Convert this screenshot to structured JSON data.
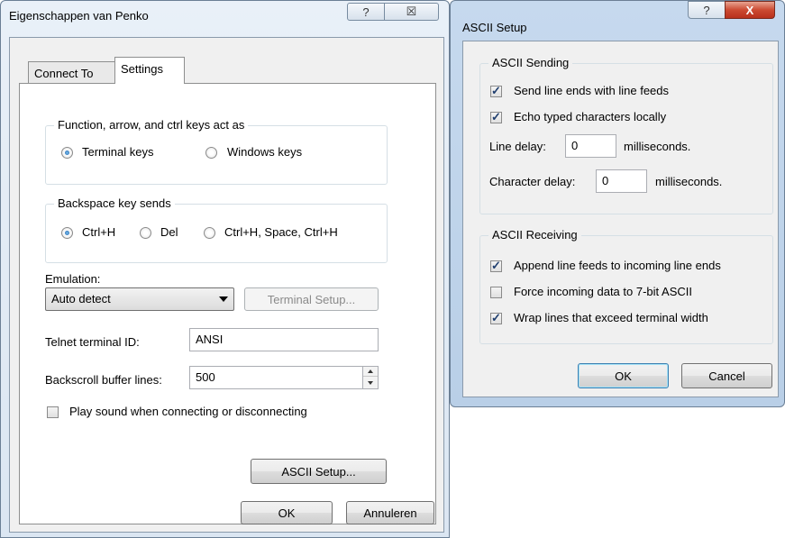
{
  "props": {
    "title": "Eigenschappen van Penko",
    "help_glyph": "?",
    "close_glyph": "☒",
    "tabs": [
      {
        "label": "Connect To"
      },
      {
        "label": "Settings"
      }
    ],
    "keys_group": {
      "title": "Function, arrow, and ctrl keys act as",
      "options": [
        {
          "label": "Terminal keys",
          "selected": true
        },
        {
          "label": "Windows keys",
          "selected": false
        }
      ]
    },
    "backspace_group": {
      "title": "Backspace key sends",
      "options": [
        {
          "label": "Ctrl+H",
          "selected": true
        },
        {
          "label": "Del",
          "selected": false
        },
        {
          "label": "Ctrl+H, Space, Ctrl+H",
          "selected": false
        }
      ]
    },
    "emulation_label": "Emulation:",
    "emulation_value": "Auto detect",
    "terminal_setup_button": "Terminal Setup...",
    "telnet_id_label": "Telnet terminal ID:",
    "telnet_id_value": "ANSI",
    "backscroll_label": "Backscroll buffer lines:",
    "backscroll_value": "500",
    "play_sound_label": "Play sound when connecting or disconnecting",
    "play_sound_checked": false,
    "ascii_setup_button": "ASCII Setup...",
    "ok_button": "OK",
    "cancel_button": "Annuleren"
  },
  "ascii": {
    "title": "ASCII Setup",
    "help_glyph": "?",
    "close_glyph": "X",
    "sending": {
      "title": "ASCII Sending",
      "send_line_ends_label": "Send line ends with line feeds",
      "send_line_ends_checked": true,
      "echo_label": "Echo typed characters locally",
      "echo_checked": true,
      "line_delay_label": "Line delay:",
      "line_delay_value": "0",
      "line_delay_unit": "milliseconds.",
      "char_delay_label": "Character delay:",
      "char_delay_value": "0",
      "char_delay_unit": "milliseconds."
    },
    "receiving": {
      "title": "ASCII Receiving",
      "append_label": "Append line feeds to incoming line ends",
      "append_checked": true,
      "force_label": "Force incoming data to 7-bit ASCII",
      "force_checked": false,
      "wrap_label": "Wrap lines that exceed terminal width",
      "wrap_checked": true
    },
    "ok_button": "OK",
    "cancel_button": "Cancel"
  }
}
